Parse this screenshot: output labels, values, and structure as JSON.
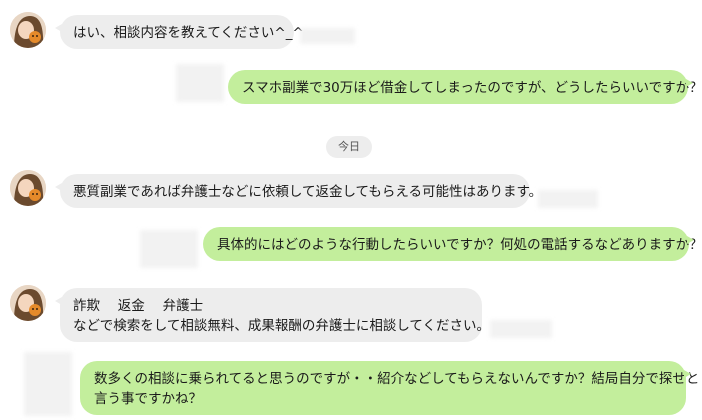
{
  "colors": {
    "incoming_bubble": "#ededed",
    "outgoing_bubble": "#c3ee9c",
    "background": "#ffffff"
  },
  "date_separator": "今日",
  "messages": [
    {
      "direction": "incoming",
      "lines": [
        "はい、相談内容を教えてください^_^"
      ]
    },
    {
      "direction": "outgoing",
      "lines": [
        "スマホ副業で30万ほど借金してしまったのですが、どうしたらいいですか？？"
      ]
    },
    {
      "direction": "incoming",
      "lines": [
        "悪質副業であれば弁護士などに依頼して返金してもらえる可能性はあります。"
      ]
    },
    {
      "direction": "outgoing",
      "lines": [
        "具体的にはどのような行動したらいいですか？何処の電話するなどありますか？"
      ]
    },
    {
      "direction": "incoming",
      "lines": [
        "詐欺　 返金　 弁護士",
        "などで検索をして相談無料、成果報酬の弁護士に相談してください。"
      ]
    },
    {
      "direction": "outgoing",
      "lines": [
        "数多くの相談に乗られてると思うのですが・・紹介などしてもらえないんですか？結局自分で探せと",
        "言う事ですかね？"
      ]
    }
  ],
  "avatar_icon": "operator-avatar-icon"
}
